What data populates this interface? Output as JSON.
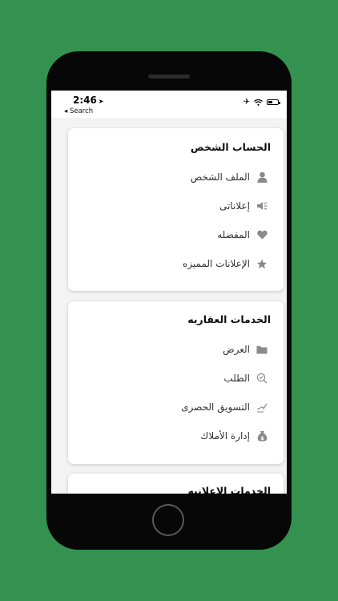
{
  "status_bar": {
    "time": "2:46",
    "back_label": "◂ Search"
  },
  "sections": [
    {
      "title": "الحساب الشخص",
      "items": [
        {
          "label": "الملف الشخص",
          "icon": "person-icon"
        },
        {
          "label": "إعلاناتى",
          "icon": "megaphone-icon"
        },
        {
          "label": "المفضله",
          "icon": "heart-icon"
        },
        {
          "label": "الإعلانات المميزه",
          "icon": "star-icon"
        }
      ]
    },
    {
      "title": "الخدمات العقاريه",
      "items": [
        {
          "label": "العرض",
          "icon": "folder-icon"
        },
        {
          "label": "الطلب",
          "icon": "request-icon"
        },
        {
          "label": "التسويق الحصرى",
          "icon": "signature-icon"
        },
        {
          "label": "إدارة الأملاك",
          "icon": "money-bag-icon"
        }
      ]
    },
    {
      "title": "الخدمات الإعلانيه"
    }
  ],
  "colors": {
    "background": "#33924f",
    "icon_gray": "#8a8a8a"
  }
}
